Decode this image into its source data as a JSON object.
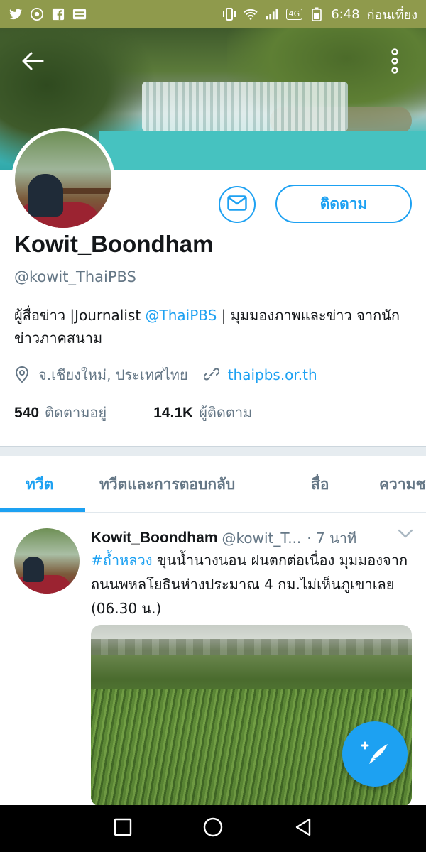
{
  "status_bar": {
    "time": "6:48",
    "period": "ก่อนเที่ยง",
    "network_badge": "4G",
    "icons": [
      "twitter-icon",
      "chrome-icon",
      "facebook-icon",
      "webtoon-icon",
      "vibrate-icon",
      "wifi-icon",
      "signal-icon",
      "battery-icon"
    ]
  },
  "toolbar": {
    "back_icon": "arrow-back-icon",
    "more_icon": "more-vertical-icon"
  },
  "profile": {
    "name": "Kowit_Boondham",
    "handle": "@kowit_ThaiPBS",
    "bio_prefix": "ผู้สื่อข่าว |Journalist ",
    "bio_mention": "@ThaiPBS",
    "bio_suffix": " | มุมมองภาพและข่าว จากนักข่าวภาคสนาม",
    "location": "จ.เชียงใหม่, ประเทศไทย",
    "website": "thaipbs.or.th",
    "following_count": "540",
    "following_label": "ติดตามอยู่",
    "followers_count": "14.1K",
    "followers_label": "ผู้ติดตาม",
    "follow_button": "ติดตาม",
    "message_icon": "mail-icon"
  },
  "tabs": [
    {
      "label": "ทวีต",
      "active": true
    },
    {
      "label": "ทวีตและการตอบกลับ",
      "active": false
    },
    {
      "label": "สื่อ",
      "active": false
    },
    {
      "label": "ความชอบ",
      "active": false
    }
  ],
  "tweet": {
    "author_name": "Kowit_Boondham",
    "author_handle": "@kowit_T...",
    "time": "· 7 นาที",
    "hashtag": "#ถ้ำหลวง",
    "text": " ขุนน้ำนางนอน ฝนตกต่อเนื่อง มุมมองจากถนนพหลโยธินห่างประมาณ 4 กม.ไม่เห็นภูเขาเลย (06.30 น.)"
  },
  "fab": {
    "icon": "compose-tweet-icon"
  },
  "nav": {
    "icons": [
      "recents-icon",
      "home-icon",
      "back-triangle-icon"
    ]
  },
  "colors": {
    "accent": "#1da1f2",
    "status_bar": "#8f9a4c",
    "secondary_text": "#657786"
  }
}
